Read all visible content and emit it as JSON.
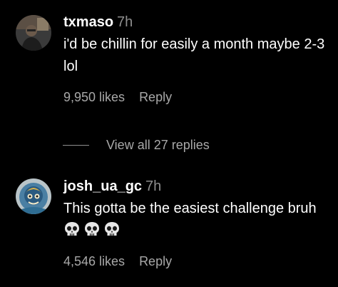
{
  "comments": [
    {
      "username": "txmaso",
      "time": "7h",
      "text": "i'd be chillin for easily a month maybe 2-3 lol",
      "likes": "9,950 likes",
      "reply_label": "Reply",
      "avatar_icon": "user-photo-avatar"
    },
    {
      "username": "josh_ua_gc",
      "time": "7h",
      "text": "This gotta be the easiest challenge bruh",
      "emoji": [
        "skull",
        "skull",
        "skull"
      ],
      "likes": "4,546 likes",
      "reply_label": "Reply",
      "avatar_icon": "character-avatar"
    }
  ],
  "view_replies": {
    "label": "View all 27 replies"
  },
  "colors": {
    "background": "#000000",
    "primary_text": "#ffffff",
    "secondary_text": "#a8a8a8",
    "time_text": "#8e8e8e"
  }
}
